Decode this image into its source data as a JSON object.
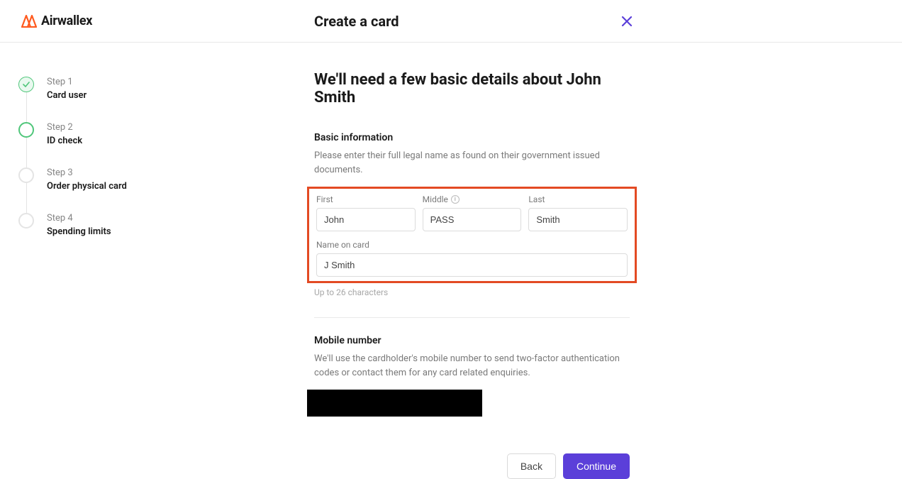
{
  "header": {
    "brand": "Airwallex",
    "title": "Create a card"
  },
  "steps": [
    {
      "label": "Step 1",
      "name": "Card user",
      "state": "done"
    },
    {
      "label": "Step 2",
      "name": "ID check",
      "state": "current"
    },
    {
      "label": "Step 3",
      "name": "Order physical card",
      "state": "pending"
    },
    {
      "label": "Step 4",
      "name": "Spending limits",
      "state": "pending"
    }
  ],
  "main": {
    "heading": "We'll need a few basic details about John Smith",
    "basic_info_title": "Basic information",
    "basic_info_desc": "Please enter their full legal name as found on their government issued documents.",
    "fields": {
      "first_label": "First",
      "first_value": "John",
      "middle_label": "Middle",
      "middle_value": "PASS",
      "last_label": "Last",
      "last_value": "Smith",
      "name_on_card_label": "Name on card",
      "name_on_card_value": "J Smith",
      "name_on_card_helper": "Up to 26 characters"
    },
    "mobile_title": "Mobile number",
    "mobile_desc": "We'll use the cardholder's mobile number to send two-factor authentication codes or contact them for any card related enquiries."
  },
  "footer": {
    "back": "Back",
    "continue": "Continue"
  }
}
